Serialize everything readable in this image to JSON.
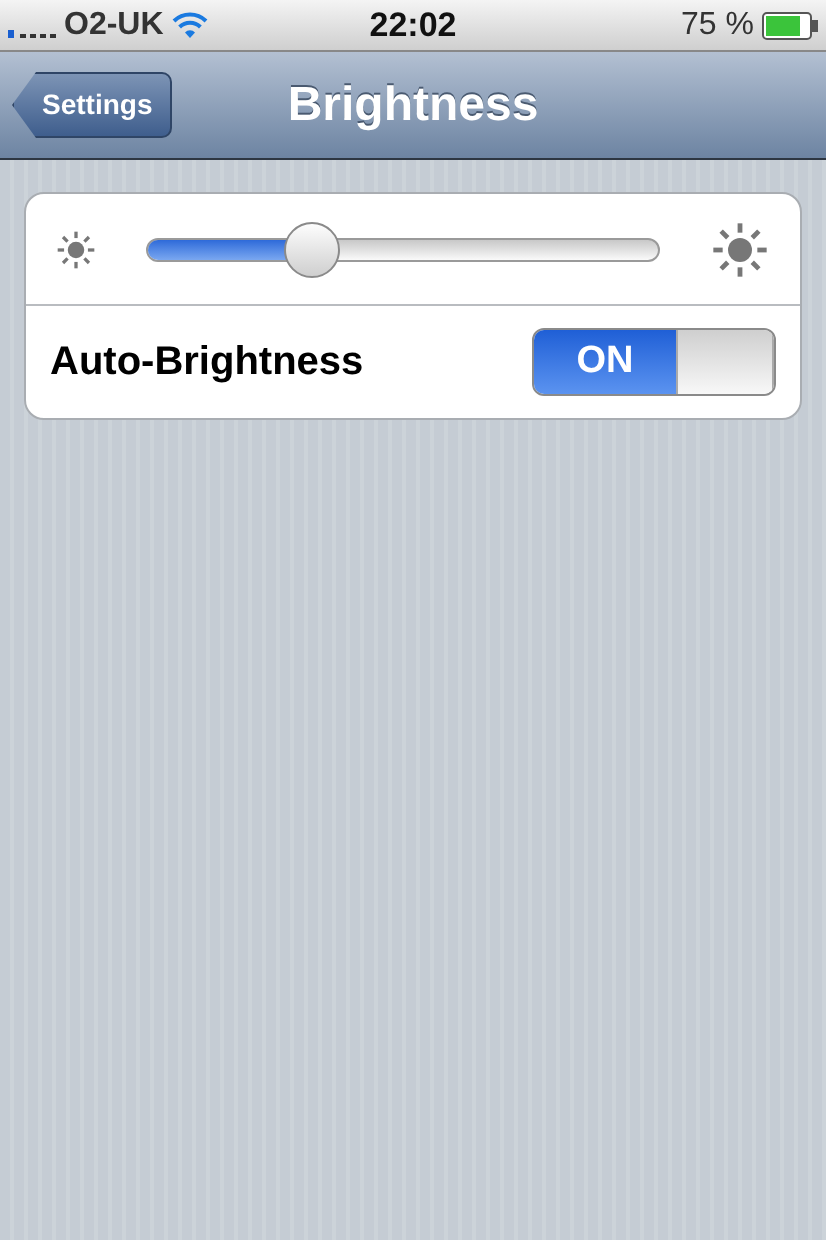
{
  "status_bar": {
    "carrier": "O2-UK",
    "time": "22:02",
    "battery": "75 %"
  },
  "nav_bar": {
    "back_button": "Settings",
    "title": "Brightness"
  },
  "brightness": {
    "level": 0.32
  },
  "auto_brightness": {
    "label": "Auto-Brightness",
    "on": true,
    "switch_text": "ON"
  }
}
